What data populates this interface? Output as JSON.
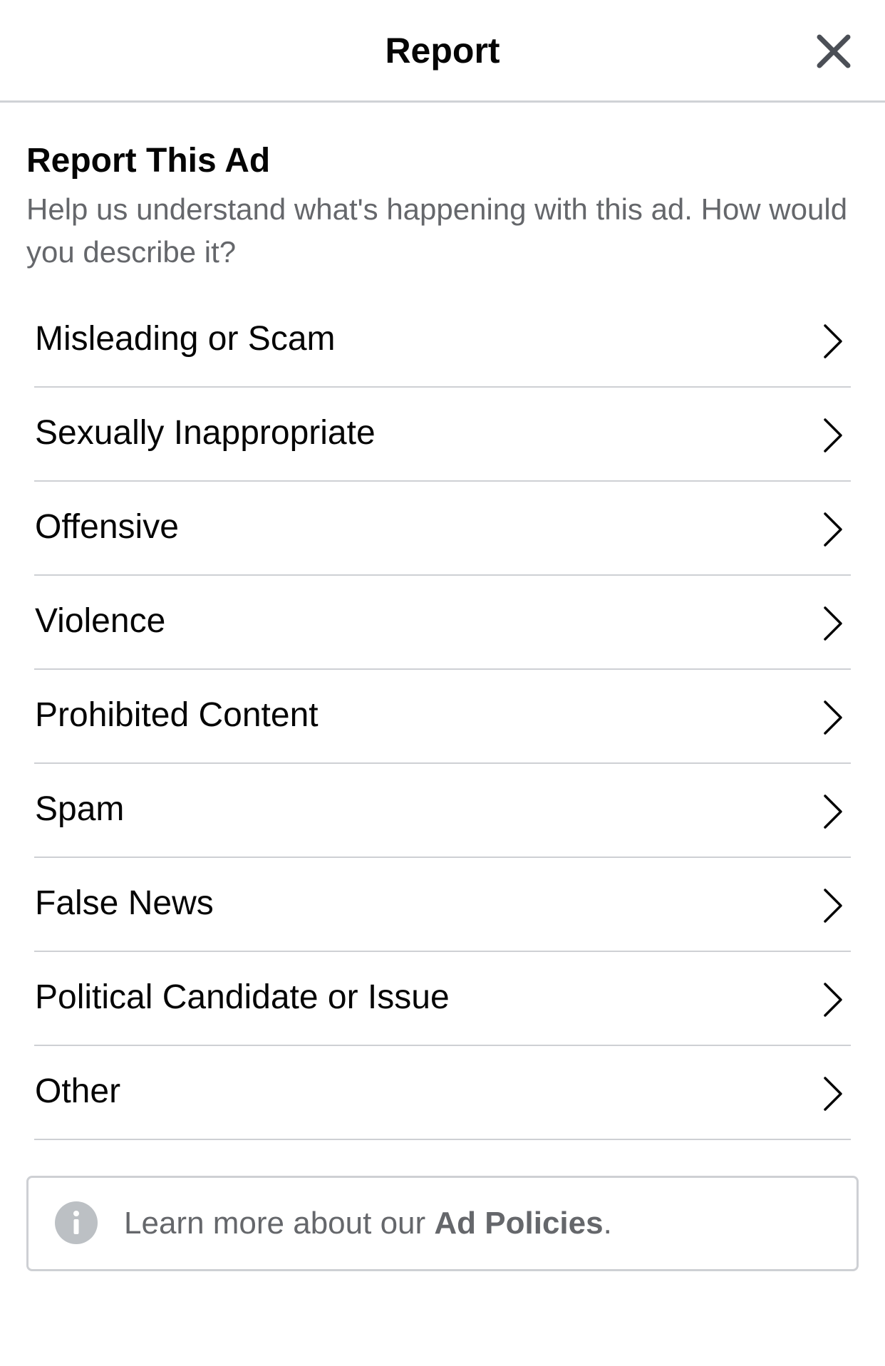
{
  "header": {
    "title": "Report",
    "close_icon": "close-icon"
  },
  "intro": {
    "title": "Report This Ad",
    "description": "Help us understand what's happening with this ad. How would you describe it?"
  },
  "options": [
    {
      "label": "Misleading or Scam",
      "icon": "chevron-right-icon"
    },
    {
      "label": "Sexually Inappropriate",
      "icon": "chevron-right-icon"
    },
    {
      "label": "Offensive",
      "icon": "chevron-right-icon"
    },
    {
      "label": "Violence",
      "icon": "chevron-right-icon"
    },
    {
      "label": "Prohibited Content",
      "icon": "chevron-right-icon"
    },
    {
      "label": "Spam",
      "icon": "chevron-right-icon"
    },
    {
      "label": "False News",
      "icon": "chevron-right-icon"
    },
    {
      "label": "Political Candidate or Issue",
      "icon": "chevron-right-icon"
    },
    {
      "label": "Other",
      "icon": "chevron-right-icon"
    }
  ],
  "info": {
    "icon": "info-icon",
    "prefix": "Learn more about our ",
    "link": "Ad Policies",
    "suffix": "."
  },
  "colors": {
    "text_primary": "#050505",
    "text_secondary": "#65676b",
    "divider": "#ced0d4",
    "icon_gray": "#bcc0c4"
  }
}
